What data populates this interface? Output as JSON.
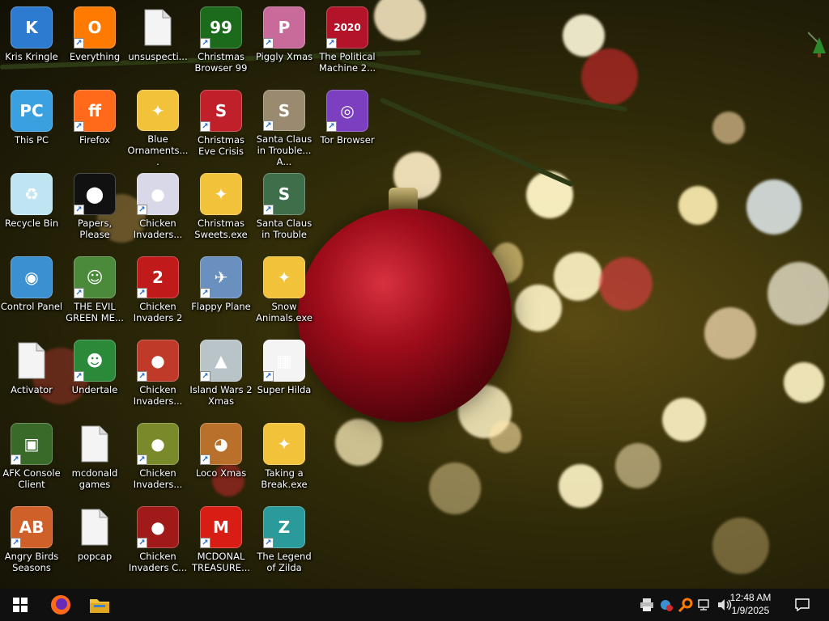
{
  "desktop": {
    "icons": [
      {
        "id": "kris-kringle",
        "label": "Kris Kringle",
        "shortcut": false,
        "color": "#2c7bd1",
        "glyph": "K"
      },
      {
        "id": "everything",
        "label": "Everything",
        "shortcut": true,
        "color": "#ff7a00",
        "glyph": "O"
      },
      {
        "id": "unsuspecti",
        "label": "unsuspecti...",
        "shortcut": false,
        "color": "#e8e8e8",
        "glyph": ""
      },
      {
        "id": "christmas-browser-99",
        "label": "Christmas Browser 99",
        "shortcut": true,
        "color": "#1c6b1c",
        "glyph": "99"
      },
      {
        "id": "piggly-xmas",
        "label": "Piggly Xmas",
        "shortcut": true,
        "color": "#c86a9a",
        "glyph": "P"
      },
      {
        "id": "political-machine",
        "label": "The Political Machine 2...",
        "shortcut": true,
        "color": "#b4142a",
        "glyph": "2020"
      },
      {
        "id": "this-pc",
        "label": "This PC",
        "shortcut": false,
        "color": "#3aa0e0",
        "glyph": "PC"
      },
      {
        "id": "firefox",
        "label": "Firefox",
        "shortcut": true,
        "color": "#ff6a1a",
        "glyph": "ff"
      },
      {
        "id": "blue-ornaments",
        "label": "Blue Ornaments....",
        "shortcut": false,
        "color": "#f2c23a",
        "glyph": "✦"
      },
      {
        "id": "christmas-eve-crisis",
        "label": "Christmas Eve Crisis",
        "shortcut": true,
        "color": "#c0202a",
        "glyph": "S"
      },
      {
        "id": "santa-claus-trouble-a",
        "label": "Santa Claus in Trouble... A...",
        "shortcut": true,
        "color": "#9a8a70",
        "glyph": "S"
      },
      {
        "id": "tor-browser",
        "label": "Tor Browser",
        "shortcut": true,
        "color": "#7b3fbf",
        "glyph": "◎"
      },
      {
        "id": "recycle-bin",
        "label": "Recycle Bin",
        "shortcut": false,
        "color": "#bfe4f2",
        "glyph": "♻"
      },
      {
        "id": "papers-please",
        "label": "Papers, Please",
        "shortcut": true,
        "color": "#111111",
        "glyph": "⬤"
      },
      {
        "id": "chicken-invaders-1",
        "label": "Chicken Invaders...",
        "shortcut": true,
        "color": "#d8d8e8",
        "glyph": "●"
      },
      {
        "id": "christmas-sweets",
        "label": "Christmas Sweets.exe",
        "shortcut": false,
        "color": "#f2c23a",
        "glyph": "✦"
      },
      {
        "id": "santa-claus-trouble",
        "label": "Santa Claus in Trouble",
        "shortcut": true,
        "color": "#3f6f4a",
        "glyph": "S"
      },
      {
        "id": "control-panel",
        "label": "Control Panel",
        "shortcut": false,
        "color": "#3a90d0",
        "glyph": "◉"
      },
      {
        "id": "the-evil-green",
        "label": "THE EVIL GREEN ME...",
        "shortcut": true,
        "color": "#4a8a3a",
        "glyph": "☺"
      },
      {
        "id": "chicken-invaders-2",
        "label": "Chicken Invaders 2",
        "shortcut": true,
        "color": "#c01a1a",
        "glyph": "2"
      },
      {
        "id": "flappy-plane",
        "label": "Flappy Plane",
        "shortcut": true,
        "color": "#6a90c0",
        "glyph": "✈"
      },
      {
        "id": "snow-animals",
        "label": "Snow Animals.exe",
        "shortcut": false,
        "color": "#f2c23a",
        "glyph": "✦"
      },
      {
        "id": "activator",
        "label": "Activator",
        "shortcut": false,
        "color": "#e8e8e8",
        "glyph": ""
      },
      {
        "id": "undertale",
        "label": "Undertale",
        "shortcut": true,
        "color": "#2a8a3a",
        "glyph": "☻"
      },
      {
        "id": "chicken-invaders-3",
        "label": "Chicken Invaders...",
        "shortcut": true,
        "color": "#c03a2a",
        "glyph": "●"
      },
      {
        "id": "island-wars-2-xmas",
        "label": "Island Wars 2 Xmas",
        "shortcut": true,
        "color": "#b8c4c8",
        "glyph": "▲"
      },
      {
        "id": "super-hilda",
        "label": "Super Hilda",
        "shortcut": true,
        "color": "#f4f4f4",
        "glyph": "▦"
      },
      {
        "id": "afk-console-client",
        "label": "AFK Console Client",
        "shortcut": true,
        "color": "#3a6a2a",
        "glyph": "▣"
      },
      {
        "id": "mcdonald-games",
        "label": "mcdonald games",
        "shortcut": false,
        "color": "#e8e8e8",
        "glyph": ""
      },
      {
        "id": "chicken-invaders-4",
        "label": "Chicken Invaders...",
        "shortcut": true,
        "color": "#7a8a2a",
        "glyph": "●"
      },
      {
        "id": "loco-xmas",
        "label": "Loco Xmas",
        "shortcut": true,
        "color": "#b8702a",
        "glyph": "◕"
      },
      {
        "id": "taking-a-break",
        "label": "Taking a Break.exe",
        "shortcut": false,
        "color": "#f2c23a",
        "glyph": "✦"
      },
      {
        "id": "angry-birds-seasons",
        "label": "Angry Birds Seasons",
        "shortcut": true,
        "color": "#d0602a",
        "glyph": "AB"
      },
      {
        "id": "popcap",
        "label": "popcap",
        "shortcut": false,
        "color": "#e8e8e8",
        "glyph": ""
      },
      {
        "id": "chicken-invaders-c",
        "label": "Chicken Invaders C...",
        "shortcut": true,
        "color": "#a01a1a",
        "glyph": "●"
      },
      {
        "id": "mcdonal-treasure",
        "label": "MCDONAL TREASURE...",
        "shortcut": true,
        "color": "#d81e14",
        "glyph": "M"
      },
      {
        "id": "legend-of-zilda",
        "label": "The Legend of Zilda",
        "shortcut": true,
        "color": "#2a9a9a",
        "glyph": "Z"
      }
    ],
    "corner_icon": {
      "name": "tree-icon",
      "color": "#2a8a2a"
    }
  },
  "taskbar": {
    "start_icon": "windows-start-icon",
    "pinned": [
      {
        "name": "firefox-taskbar-icon",
        "color": "#ff6a1a"
      },
      {
        "name": "file-explorer-taskbar-icon",
        "color": "#f2c23a"
      }
    ],
    "tray": [
      {
        "name": "printer-icon",
        "glyph": "🖶"
      },
      {
        "name": "app-tray-icon",
        "glyph": "✱"
      },
      {
        "name": "search-everything-icon",
        "glyph": "⚲"
      },
      {
        "name": "network-icon",
        "glyph": "▭"
      },
      {
        "name": "volume-icon",
        "glyph": "🔈"
      }
    ],
    "clock": {
      "time": "12:48 AM",
      "date": "1/9/2025"
    },
    "notification_icon": "notification-icon"
  }
}
